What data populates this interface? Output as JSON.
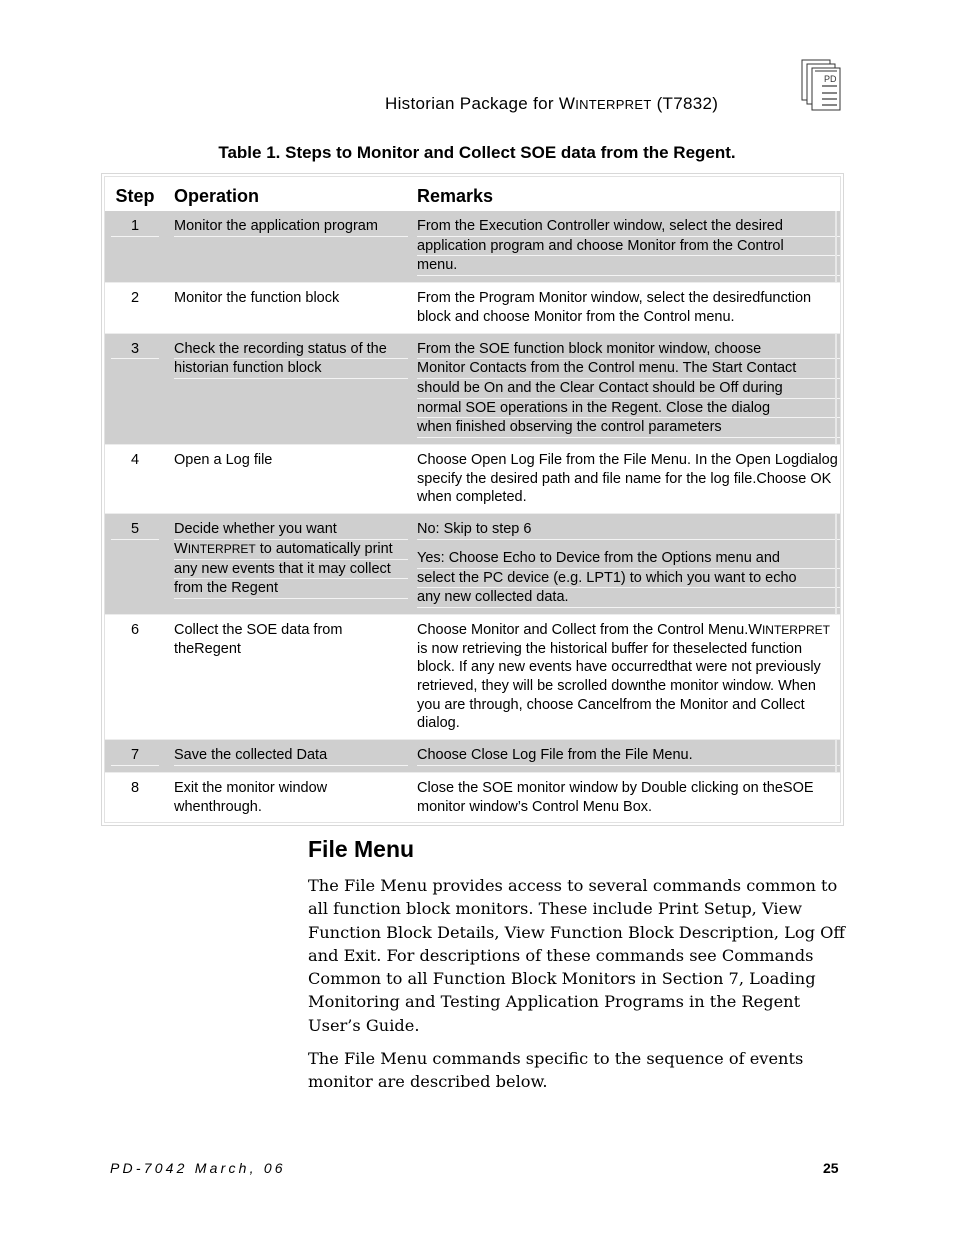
{
  "header": {
    "prefix": "Historian   Package   for W",
    "brand_small": "INTERPRET",
    "suffix": " (T7832)",
    "logo_label": "PD"
  },
  "table": {
    "title": "Table 1.  Steps to Monitor and Collect SOE data from the Regent.",
    "columns": [
      "Step",
      "Operation",
      "Remarks"
    ],
    "rows": [
      {
        "step": "1",
        "operation": [
          "Monitor the application program"
        ],
        "remarks": [
          "From the Execution Controller window, select the desired",
          "application program and choose Monitor from the Control",
          "menu."
        ]
      },
      {
        "step": "2",
        "operation": [
          "Monitor the function block"
        ],
        "remarks": [
          "From the Program Monitor window, select the desired",
          "function block and choose Monitor from the Control menu."
        ]
      },
      {
        "step": "3",
        "operation": [
          "Check the recording status of the",
          "historian function block"
        ],
        "remarks": [
          "From the SOE function block monitor window, choose",
          "Monitor Contacts from the Control menu.  The Start Contact",
          "should be On and the Clear Contact should be Off during",
          "normal SOE operations in the Regent.  Close the dialog",
          "when finished observing the control parameters"
        ]
      },
      {
        "step": "4",
        "operation": [
          "Open a Log file"
        ],
        "remarks": [
          "Choose Open Log File from the File Menu.  In the Open Log",
          "dialog specify the desired path and file name for the log file.",
          "Choose OK when completed."
        ]
      },
      {
        "step": "5",
        "operation": [
          "Decide whether you want",
          "WINTERPRET to automatically print",
          "any new events that it may collect",
          "from the Regent"
        ],
        "remarks_no": "No: Skip to step 6",
        "remarks": [
          "Yes: Choose Echo to Device from the Options menu and",
          "select the PC device (e.g. LPT1) to which you want to echo",
          "any new collected data."
        ]
      },
      {
        "step": "6",
        "operation": [
          "Collect the SOE data from the",
          "Regent"
        ],
        "remarks": [
          "Choose Monitor and Collect from the Control Menu.",
          "WINTERPRET is now retrieving the historical buffer for the",
          "selected function block.  If any new events have occurred",
          "that were not previously retrieved, they will be scrolled down",
          "the monitor window.  When you are through, choose Cancel",
          "from the Monitor and Collect dialog."
        ]
      },
      {
        "step": "7",
        "operation": [
          "Save the collected Data"
        ],
        "remarks": [
          "Choose Close Log File from the File Menu."
        ]
      },
      {
        "step": "8",
        "operation": [
          "Exit the monitor window when",
          "through."
        ],
        "remarks": [
          "Close the SOE monitor window by Double clicking on the",
          "SOE monitor window’s Control Menu Box."
        ]
      }
    ]
  },
  "section": {
    "title": "File Menu",
    "paragraphs": [
      "The File Menu provides access to several commands common to all function block monitors.  These include Print Setup, View Function Block Details, View Function Block Description, Log Off and Exit.  For descriptions of these commands see Commands Common to all Function Block Monitors in Section 7, Loading Monitoring and Testing Application Programs in the Regent User’s Guide.",
      "The File Menu commands specific to the sequence of events monitor are described below."
    ]
  },
  "footer": {
    "doc_id": "PD-7042 March, 06",
    "page_number": "25"
  }
}
